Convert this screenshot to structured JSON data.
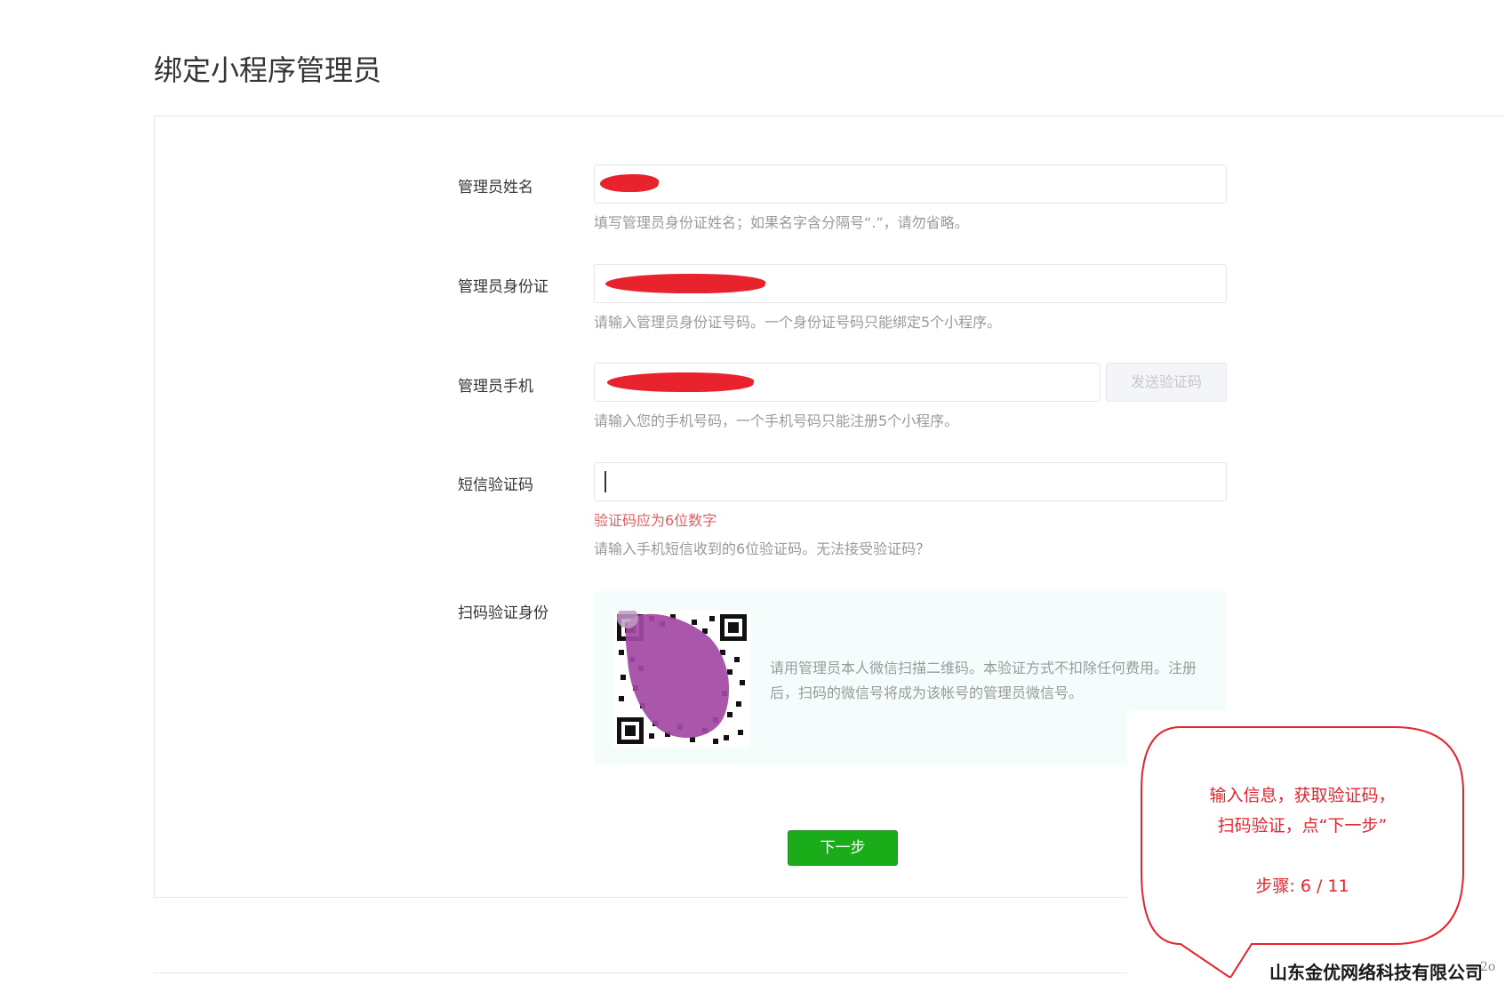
{
  "page": {
    "title": "绑定小程序管理员"
  },
  "form": {
    "name": {
      "label": "管理员姓名",
      "hint": "填写管理员身份证姓名；如果名字含分隔号“.”，请勿省略。"
    },
    "id_card": {
      "label": "管理员身份证",
      "hint": "请输入管理员身份证号码。一个身份证号码只能绑定5个小程序。"
    },
    "phone": {
      "label": "管理员手机",
      "send_code_label": "发送验证码",
      "hint": "请输入您的手机号码，一个手机号码只能注册5个小程序。"
    },
    "sms_code": {
      "label": "短信验证码",
      "value": "",
      "error": "验证码应为6位数字",
      "hint": "请输入手机短信收到的6位验证码。无法接受验证码？"
    },
    "scan": {
      "label": "扫码验证身份",
      "description": "请用管理员本人微信扫描二维码。本验证方式不扣除任何费用。注册后，扫码的微信号将成为该帐号的管理员微信号。"
    },
    "next_label": "下一步"
  },
  "tutorial_bubble": {
    "line1": "输入信息，获取验证码，",
    "line2": "扫码验证，点“下一步”",
    "step": "步骤:  6  /  11"
  },
  "watermark": {
    "company": "山东金优网络科技有限公司",
    "tail": "2o"
  },
  "colors": {
    "primary_green": "#1aad19",
    "error_red": "#e15f63",
    "annotation_red": "#e8232e",
    "redaction_purple": "#a349a4"
  }
}
